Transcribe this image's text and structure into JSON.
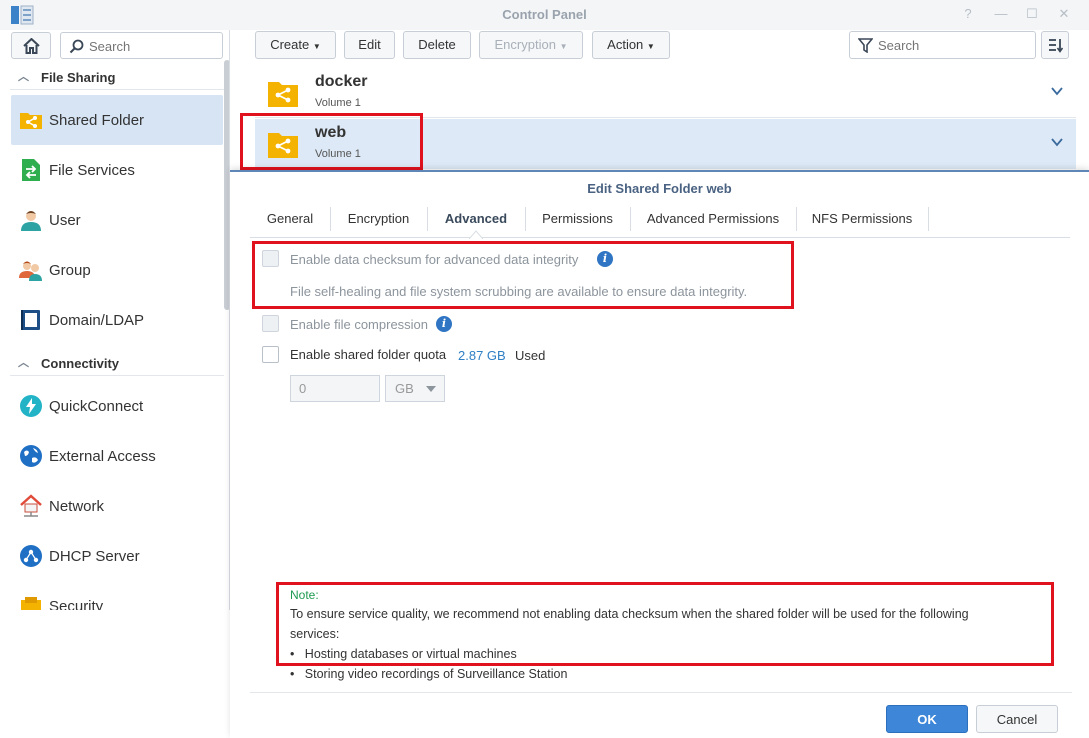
{
  "window": {
    "title": "Control Panel",
    "controls": [
      "?",
      "—",
      "☐",
      "✕"
    ]
  },
  "sidebar": {
    "search_placeholder": "Search",
    "sections": [
      {
        "label": "File Sharing"
      },
      {
        "label": "Connectivity"
      }
    ],
    "items": [
      {
        "label": "Shared Folder",
        "icon": "shared-folder-icon",
        "active": true
      },
      {
        "label": "File Services",
        "icon": "file-services-icon"
      },
      {
        "label": "User",
        "icon": "user-icon"
      },
      {
        "label": "Group",
        "icon": "group-icon"
      },
      {
        "label": "Domain/LDAP",
        "icon": "domain-ldap-icon"
      },
      {
        "label": "QuickConnect",
        "icon": "quickconnect-icon"
      },
      {
        "label": "External Access",
        "icon": "external-access-icon"
      },
      {
        "label": "Network",
        "icon": "network-icon"
      },
      {
        "label": "DHCP Server",
        "icon": "dhcp-server-icon"
      },
      {
        "label": "Security",
        "icon": "security-icon"
      }
    ]
  },
  "toolbar": {
    "create": "Create",
    "edit": "Edit",
    "delete": "Delete",
    "encryption": "Encryption",
    "action": "Action",
    "search_placeholder": "Search"
  },
  "folders": [
    {
      "name": "docker",
      "volume": "Volume 1"
    },
    {
      "name": "web",
      "volume": "Volume 1",
      "selected": true
    }
  ],
  "dialog": {
    "title": "Edit Shared Folder web",
    "tabs": [
      "General",
      "Encryption",
      "Advanced",
      "Permissions",
      "Advanced Permissions",
      "NFS Permissions"
    ],
    "active_tab": "Advanced",
    "checksum_label": "Enable data checksum for advanced data integrity",
    "checksum_desc": "File self-healing and file system scrubbing are available to ensure data integrity.",
    "compression_label": "Enable file compression",
    "quota_label": "Enable shared folder quota",
    "quota_used_value": "2.87 GB",
    "quota_used_suffix": "Used",
    "quota_input_value": "0",
    "quota_unit": "GB",
    "note_title": "Note:",
    "note_line1": "To ensure service quality, we recommend not enabling data checksum when the shared folder will be used for the following",
    "note_line2": "services:",
    "note_bullets": [
      "Hosting databases or virtual machines",
      "Storing video recordings of Surveillance Station"
    ],
    "ok": "OK",
    "cancel": "Cancel"
  },
  "colors": {
    "accent": "#3d86d8",
    "highlight_box": "#e0121e",
    "note_title": "#1e9a52",
    "folder": "#f5b301"
  }
}
